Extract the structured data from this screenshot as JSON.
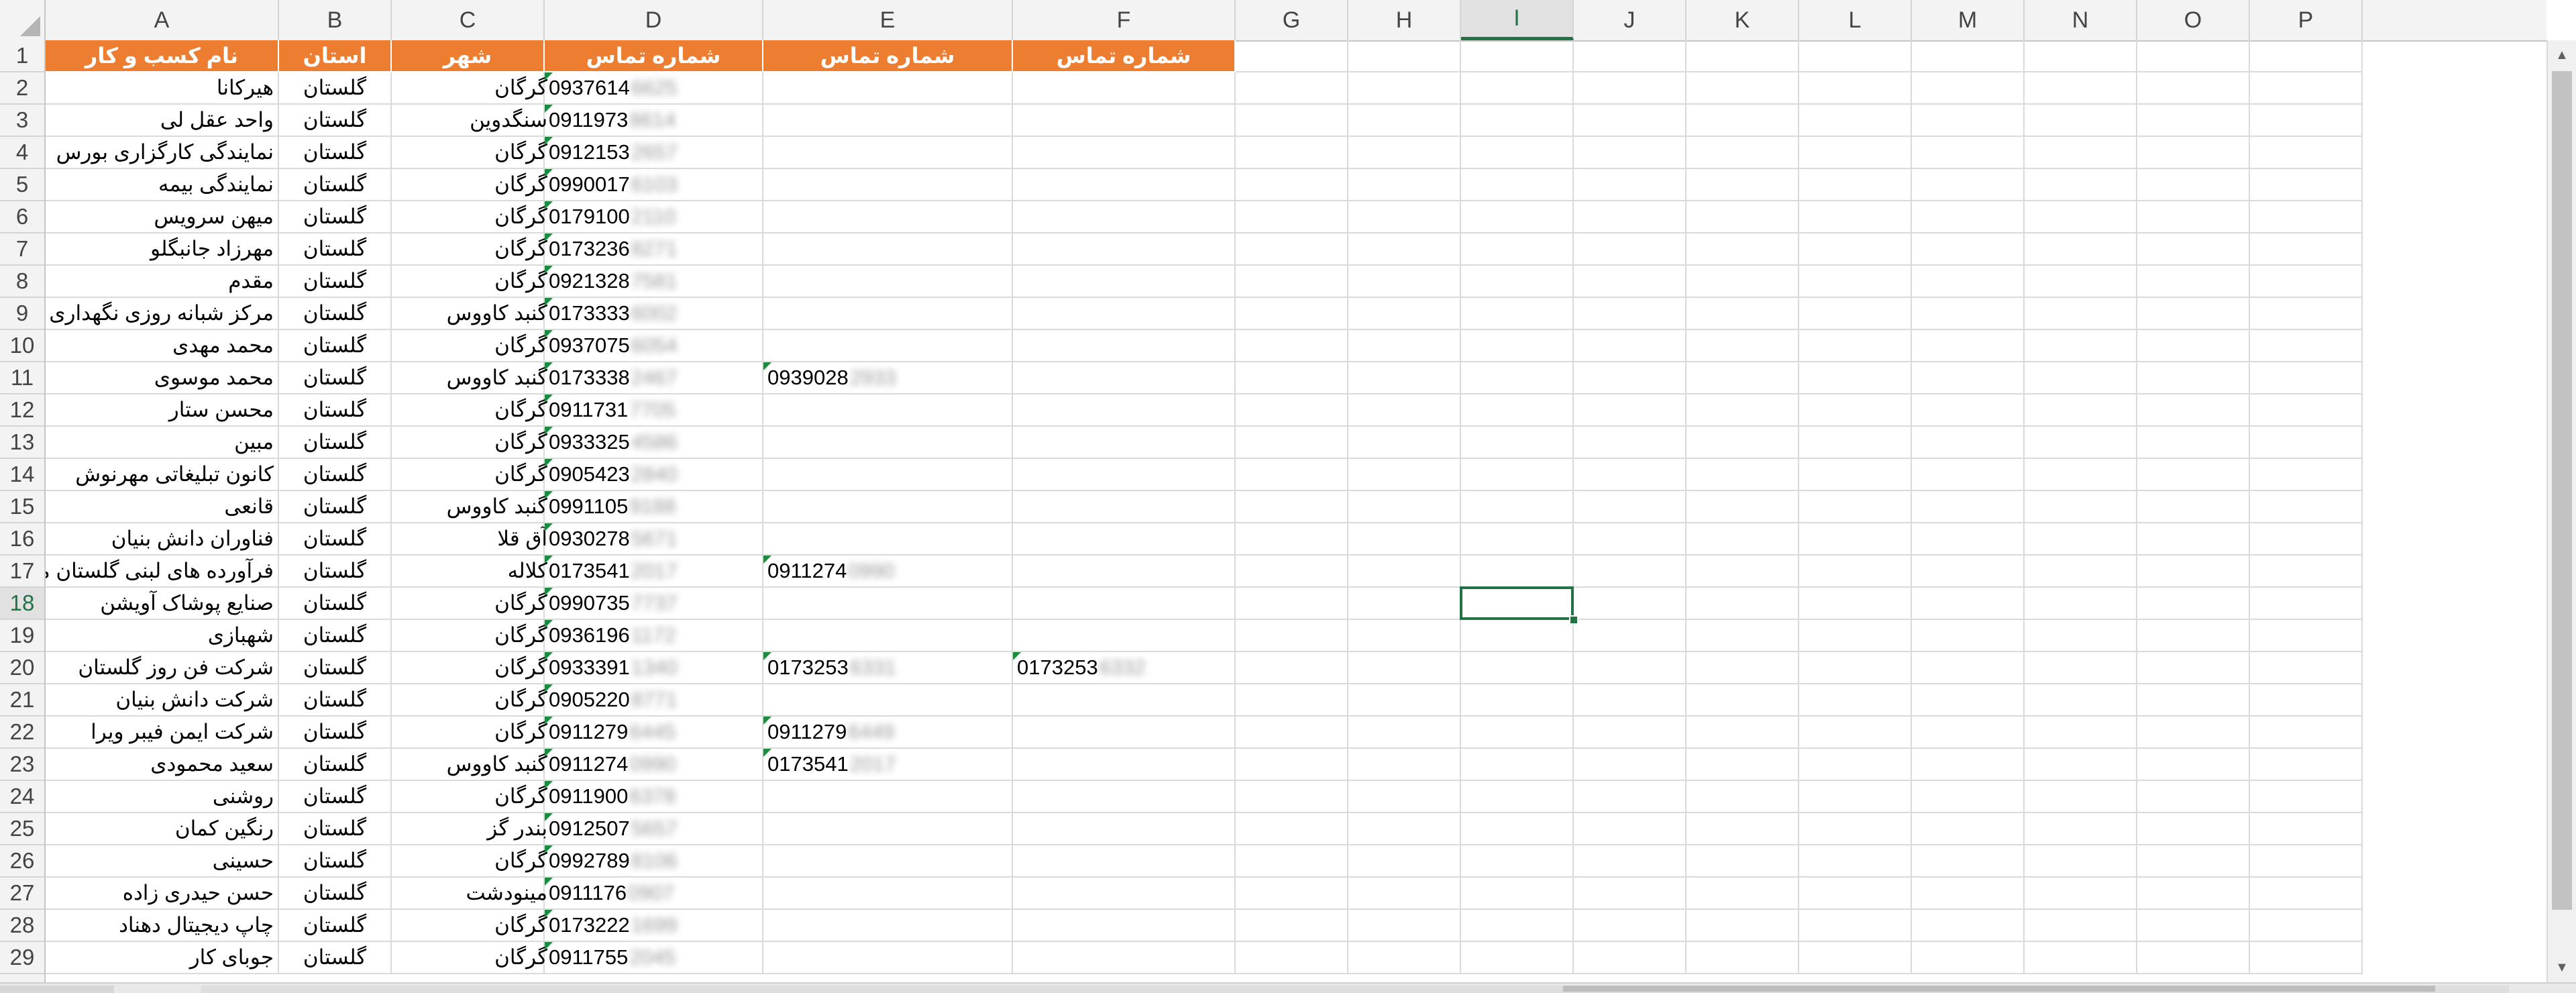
{
  "columns": [
    "A",
    "B",
    "C",
    "D",
    "E",
    "F",
    "G",
    "H",
    "I",
    "J",
    "K",
    "L",
    "M",
    "N",
    "O",
    "P"
  ],
  "active_column": "I",
  "active_row": 18,
  "row_numbers": [
    1,
    2,
    3,
    4,
    5,
    6,
    7,
    8,
    9,
    10,
    11,
    12,
    13,
    14,
    15,
    16,
    17,
    18,
    19,
    20,
    21,
    22,
    23,
    24,
    25,
    26,
    27,
    28,
    29
  ],
  "header_row": {
    "A": "نام کسب و کار",
    "B": "استان",
    "C": "شهر",
    "D": "شماره تماس",
    "E": "شماره تماس",
    "F": "شماره تماس"
  },
  "rows": [
    {
      "A": "هیرکانا",
      "B": "گلستان",
      "C": "گرگان",
      "D": "0937614",
      "D_hidden": "6625",
      "E": "",
      "E_hidden": "",
      "F": "",
      "F_hidden": ""
    },
    {
      "A": "واحد عقل لی",
      "B": "گلستان",
      "C": "سنگدوین",
      "D": "0911973",
      "D_hidden": "8614",
      "E": "",
      "E_hidden": "",
      "F": "",
      "F_hidden": ""
    },
    {
      "A": "نمایندگی کارگزاری بورس",
      "B": "گلستان",
      "C": "گرگان",
      "D": "0912153",
      "D_hidden": "2657",
      "E": "",
      "E_hidden": "",
      "F": "",
      "F_hidden": ""
    },
    {
      "A": "نمایندگی بیمه",
      "B": "گلستان",
      "C": "گرگان",
      "D": "0990017",
      "D_hidden": "6103",
      "E": "",
      "E_hidden": "",
      "F": "",
      "F_hidden": ""
    },
    {
      "A": "میهن سرویس",
      "B": "گلستان",
      "C": "گرگان",
      "D": "0179100",
      "D_hidden": "2110",
      "E": "",
      "E_hidden": "",
      "F": "",
      "F_hidden": ""
    },
    {
      "A": "مهرزاد جانبگلو",
      "B": "گلستان",
      "C": "گرگان",
      "D": "0173236",
      "D_hidden": "8271",
      "E": "",
      "E_hidden": "",
      "F": "",
      "F_hidden": ""
    },
    {
      "A": "مقدم",
      "B": "گلستان",
      "C": "گرگان",
      "D": "0921328",
      "D_hidden": "7581",
      "E": "",
      "E_hidden": "",
      "F": "",
      "F_hidden": ""
    },
    {
      "A": "مرکز شبانه روزی نگهداری معلولین جسمی گنبد",
      "B": "گلستان",
      "C": "گنبد کاووس",
      "D": "0173333",
      "D_hidden": "6002",
      "E": "",
      "E_hidden": "",
      "F": "",
      "F_hidden": ""
    },
    {
      "A": "محمد مهدی",
      "B": "گلستان",
      "C": "گرگان",
      "D": "0937075",
      "D_hidden": "6054",
      "E": "",
      "E_hidden": "",
      "F": "",
      "F_hidden": ""
    },
    {
      "A": "محمد موسوی",
      "B": "گلستان",
      "C": "گنبد کاووس",
      "D": "0173338",
      "D_hidden": "2467",
      "E": "0939028",
      "E_hidden": "2933",
      "F": "",
      "F_hidden": ""
    },
    {
      "A": "محسن ستار",
      "B": "گلستان",
      "C": "گرگان",
      "D": "0911731",
      "D_hidden": "7705",
      "E": "",
      "E_hidden": "",
      "F": "",
      "F_hidden": ""
    },
    {
      "A": "مبین",
      "B": "گلستان",
      "C": "گرگان",
      "D": "0933325",
      "D_hidden": "4586",
      "E": "",
      "E_hidden": "",
      "F": "",
      "F_hidden": ""
    },
    {
      "A": "کانون تبلیغاتی مهرنوش",
      "B": "گلستان",
      "C": "گرگان",
      "D": "0905423",
      "D_hidden": "2840",
      "E": "",
      "E_hidden": "",
      "F": "",
      "F_hidden": ""
    },
    {
      "A": "قانعی",
      "B": "گلستان",
      "C": "گنبد کاووس",
      "D": "0991105",
      "D_hidden": "9188",
      "E": "",
      "E_hidden": "",
      "F": "",
      "F_hidden": ""
    },
    {
      "A": "فناوران دانش بنیان",
      "B": "گلستان",
      "C": "آق قلا",
      "D": "0930278",
      "D_hidden": "5671",
      "E": "",
      "E_hidden": "",
      "F": "",
      "F_hidden": ""
    },
    {
      "A": "فرآورده های لبنی گلستان مینودشت",
      "B": "گلستان",
      "C": "کلاله",
      "D": "0173541",
      "D_hidden": "2017",
      "E": "0911274",
      "E_hidden": "0990",
      "F": "",
      "F_hidden": ""
    },
    {
      "A": "صنایع پوشاک آویشن",
      "B": "گلستان",
      "C": "گرگان",
      "D": "0990735",
      "D_hidden": "7737",
      "E": "",
      "E_hidden": "",
      "F": "",
      "F_hidden": ""
    },
    {
      "A": "شهبازی",
      "B": "گلستان",
      "C": "گرگان",
      "D": "0936196",
      "D_hidden": "1172",
      "E": "",
      "E_hidden": "",
      "F": "",
      "F_hidden": ""
    },
    {
      "A": "شرکت فن روز گلستان",
      "B": "گلستان",
      "C": "گرگان",
      "D": "0933391",
      "D_hidden": "1340",
      "E": "0173253",
      "E_hidden": "6331",
      "F": "0173253",
      "F_hidden": "6332"
    },
    {
      "A": "شرکت دانش بنیان",
      "B": "گلستان",
      "C": "گرگان",
      "D": "0905220",
      "D_hidden": "8771",
      "E": "",
      "E_hidden": "",
      "F": "",
      "F_hidden": ""
    },
    {
      "A": "شرکت ایمن فیبر ویرا",
      "B": "گلستان",
      "C": "گرگان",
      "D": "0911279",
      "D_hidden": "6445",
      "E": "0911279",
      "E_hidden": "6449",
      "F": "",
      "F_hidden": ""
    },
    {
      "A": "سعید محمودی",
      "B": "گلستان",
      "C": "گنبد کاووس",
      "D": "0911274",
      "D_hidden": "0990",
      "E": "0173541",
      "E_hidden": "2017",
      "F": "",
      "F_hidden": ""
    },
    {
      "A": "روشنی",
      "B": "گلستان",
      "C": "گرگان",
      "D": "0911900",
      "D_hidden": "6378",
      "E": "",
      "E_hidden": "",
      "F": "",
      "F_hidden": ""
    },
    {
      "A": "رنگین کمان",
      "B": "گلستان",
      "C": "بندر گز",
      "D": "0912507",
      "D_hidden": "5657",
      "E": "",
      "E_hidden": "",
      "F": "",
      "F_hidden": ""
    },
    {
      "A": "حسینی",
      "B": "گلستان",
      "C": "گرگان",
      "D": "0992789",
      "D_hidden": "8106",
      "E": "",
      "E_hidden": "",
      "F": "",
      "F_hidden": ""
    },
    {
      "A": "حسن حیدری زاده",
      "B": "گلستان",
      "C": "مینودشت",
      "D": "0911176",
      "D_hidden": "0907",
      "E": "",
      "E_hidden": "",
      "F": "",
      "F_hidden": ""
    },
    {
      "A": "چاپ دیجیتال دهناد",
      "B": "گلستان",
      "C": "گرگان",
      "D": "0173222",
      "D_hidden": "1699",
      "E": "",
      "E_hidden": "",
      "F": "",
      "F_hidden": ""
    },
    {
      "A": "جوبای کار",
      "B": "گلستان",
      "C": "گرگان",
      "D": "0911755",
      "D_hidden": "2045",
      "E": "",
      "E_hidden": "",
      "F": "",
      "F_hidden": ""
    }
  ],
  "colors": {
    "header_fill": "#ed7d31",
    "header_text": "#ffffff",
    "selection": "#217346",
    "comment_marker": "#1e8a3e"
  },
  "icons": {
    "select_all": "select-all-triangle-icon",
    "scroll_up": "scroll-up-arrow-icon",
    "scroll_down": "scroll-down-arrow-icon"
  },
  "scroll_arrows": {
    "up": "▲",
    "down": "▼"
  }
}
